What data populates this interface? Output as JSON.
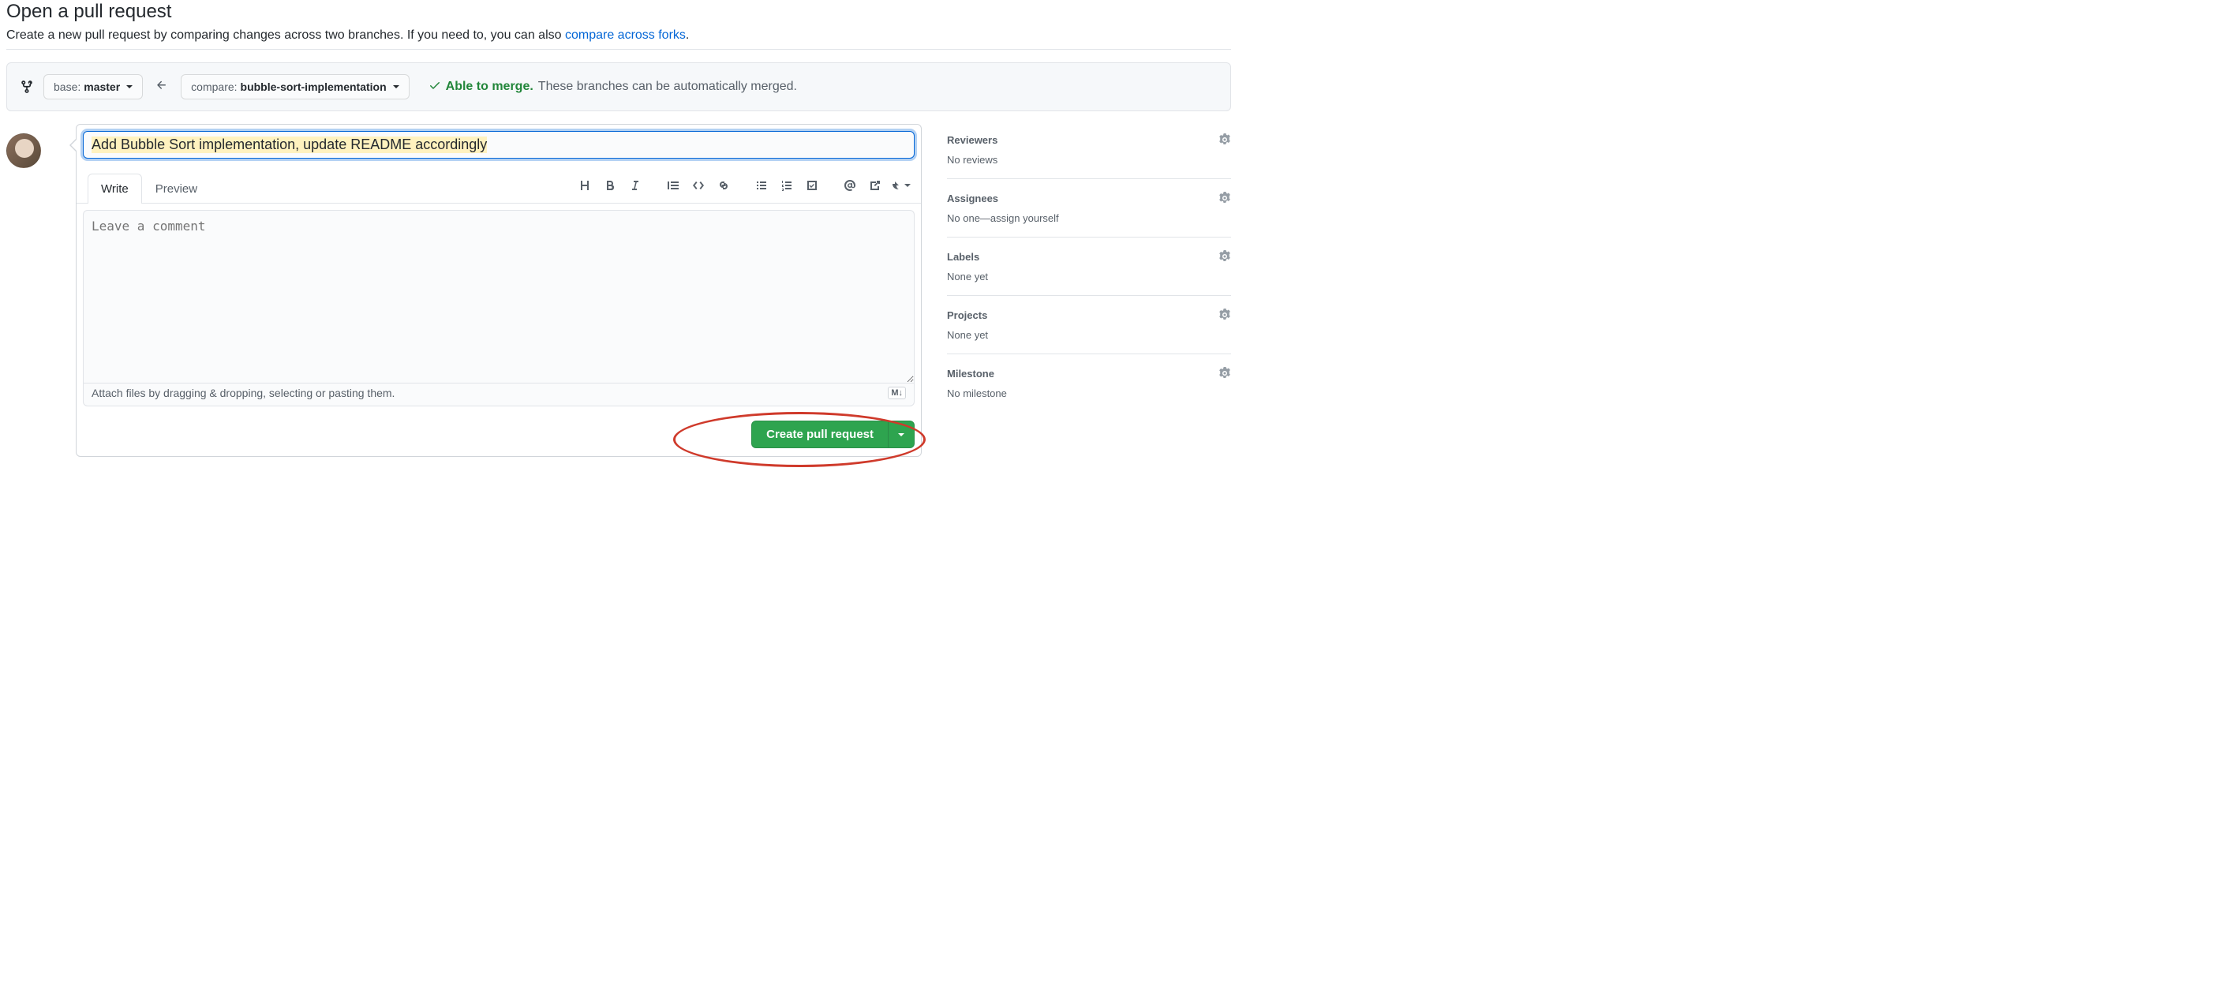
{
  "header": {
    "title": "Open a pull request",
    "subtitle_pre": "Create a new pull request by comparing changes across two branches. If you need to, you can also ",
    "subtitle_link": "compare across forks",
    "subtitle_post": "."
  },
  "compare": {
    "base_label": "base: ",
    "base_value": "master",
    "compare_label": "compare: ",
    "compare_value": "bubble-sort-implementation",
    "merge_ok": "Able to merge.",
    "merge_desc": "These branches can be automatically merged."
  },
  "form": {
    "title_value": "Add Bubble Sort implementation, update README accordingly",
    "tab_write": "Write",
    "tab_preview": "Preview",
    "comment_placeholder": "Leave a comment",
    "attach_hint": "Attach files by dragging & dropping, selecting or pasting them.",
    "md_badge": "M↓",
    "submit_label": "Create pull request"
  },
  "sidebar": {
    "reviewers": {
      "title": "Reviewers",
      "value": "No reviews"
    },
    "assignees": {
      "title": "Assignees",
      "value_pre": "No one—",
      "assign_self": "assign yourself"
    },
    "labels": {
      "title": "Labels",
      "value": "None yet"
    },
    "projects": {
      "title": "Projects",
      "value": "None yet"
    },
    "milestone": {
      "title": "Milestone",
      "value": "No milestone"
    }
  }
}
